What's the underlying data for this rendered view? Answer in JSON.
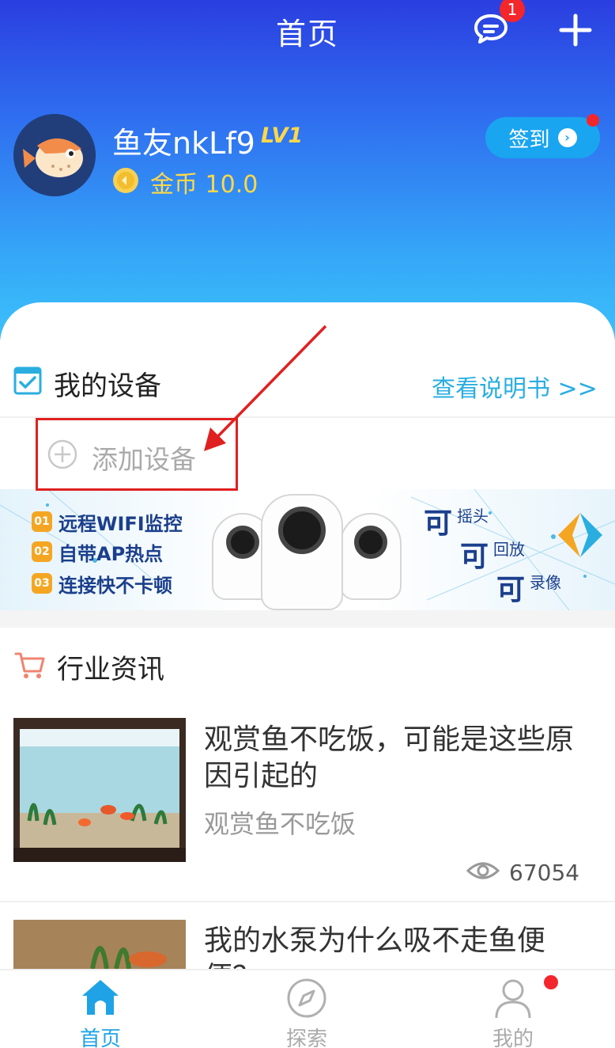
{
  "header": {
    "title": "首页",
    "message_badge": "1"
  },
  "profile": {
    "username": "鱼友nkLf9",
    "level": "LV1",
    "coins": "金币 10.0",
    "signin_label": "签到"
  },
  "devices": {
    "title": "我的设备",
    "manual_link": "查看说明书 >>",
    "add_label": "添加设备"
  },
  "banner": {
    "features": [
      {
        "num": "01",
        "text": "远程WIFI监控"
      },
      {
        "num": "02",
        "text": "自带AP热点"
      },
      {
        "num": "03",
        "text": "连接快不卡顿"
      }
    ],
    "claims": [
      {
        "big": "可",
        "small": "摇头"
      },
      {
        "big": "可",
        "small": "回放"
      },
      {
        "big": "可",
        "small": "录像"
      }
    ]
  },
  "news": {
    "title": "行业资讯",
    "articles": [
      {
        "title": "观赏鱼不吃饭，可能是这些原因引起的",
        "subtitle": "观赏鱼不吃饭",
        "views": "67054"
      },
      {
        "title": "我的水泵为什么吸不走鱼便便？"
      }
    ]
  },
  "tabs": [
    {
      "label": "首页",
      "active": true
    },
    {
      "label": "探索",
      "active": false
    },
    {
      "label": "我的",
      "active": false
    }
  ],
  "colors": {
    "accent": "#2aaee0",
    "badge": "#f3262b",
    "gold": "#ffd84a"
  }
}
